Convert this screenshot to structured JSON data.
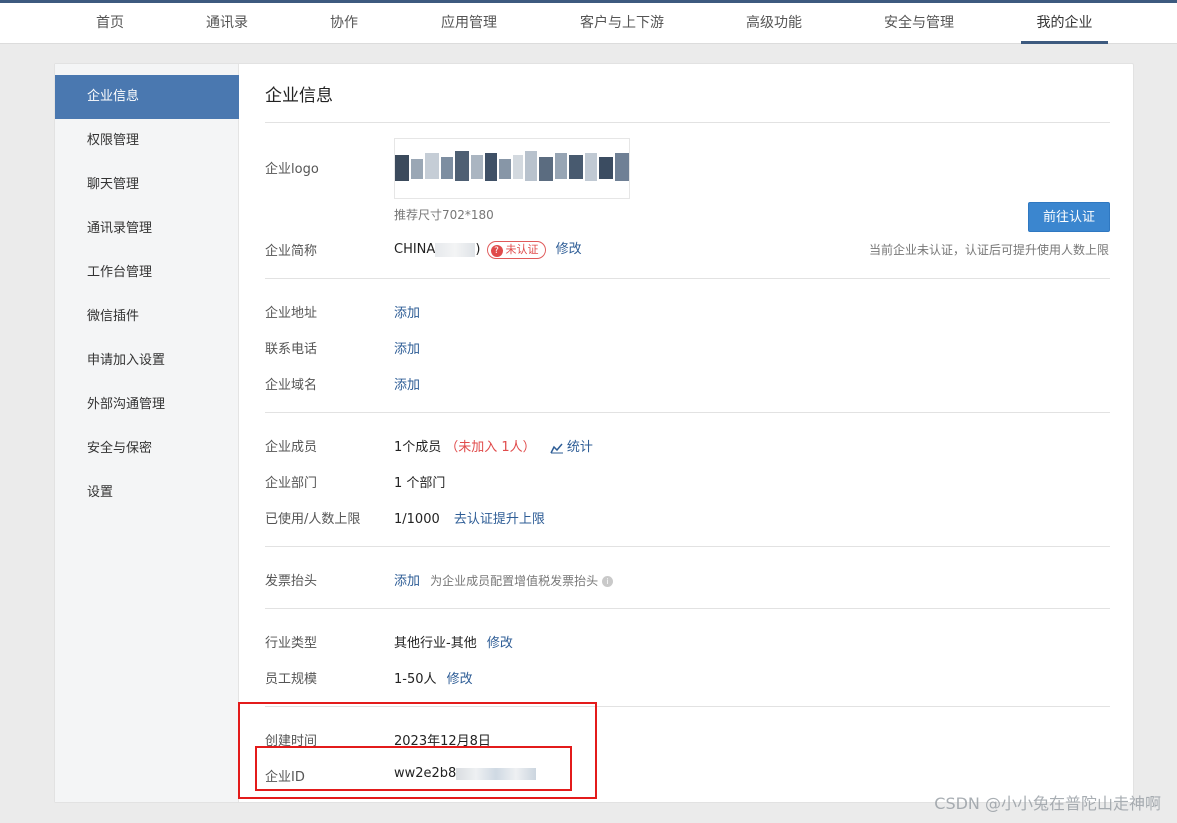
{
  "topnav": {
    "tabs": [
      {
        "label": "首页"
      },
      {
        "label": "通讯录"
      },
      {
        "label": "协作"
      },
      {
        "label": "应用管理"
      },
      {
        "label": "客户与上下游"
      },
      {
        "label": "高级功能"
      },
      {
        "label": "安全与管理"
      },
      {
        "label": "我的企业",
        "active": true
      }
    ]
  },
  "sidebar": {
    "items": [
      {
        "label": "企业信息",
        "active": true
      },
      {
        "label": "权限管理"
      },
      {
        "label": "聊天管理"
      },
      {
        "label": "通讯录管理"
      },
      {
        "label": "工作台管理"
      },
      {
        "label": "微信插件"
      },
      {
        "label": "申请加入设置"
      },
      {
        "label": "外部沟通管理"
      },
      {
        "label": "安全与保密"
      },
      {
        "label": "设置"
      }
    ]
  },
  "main": {
    "title": "企业信息",
    "logo": {
      "label": "企业logo",
      "hint": "推荐尺寸702*180"
    },
    "short_name": {
      "label": "企业简称",
      "value": "CHINA",
      "value_suffix": ")",
      "badge": "未认证",
      "edit": "修改"
    },
    "verify_button": "前往认证",
    "verify_note": "当前企业未认证，认证后可提升使用人数上限",
    "address": {
      "label": "企业地址",
      "action": "添加"
    },
    "phone": {
      "label": "联系电话",
      "action": "添加"
    },
    "domain": {
      "label": "企业域名",
      "action": "添加"
    },
    "members": {
      "label": "企业成员",
      "value": "1个成员",
      "pending": "（未加入 1人）",
      "stats": "统计"
    },
    "departments": {
      "label": "企业部门",
      "value": "1 个部门"
    },
    "usage": {
      "label": "已使用/人数上限",
      "value": "1/1000",
      "link": "去认证提升上限"
    },
    "invoice": {
      "label": "发票抬头",
      "action": "添加",
      "hint": "为企业成员配置增值税发票抬头"
    },
    "industry": {
      "label": "行业类型",
      "value": "其他行业-其他",
      "edit": "修改"
    },
    "scale": {
      "label": "员工规模",
      "value": "1-50人",
      "edit": "修改"
    },
    "created": {
      "label": "创建时间",
      "value": "2023年12月8日"
    },
    "corp_id": {
      "label": "企业ID",
      "value": "ww2e2b8"
    }
  },
  "watermark": "CSDN @小小兔在普陀山走神啊",
  "colors": {
    "accent": "#4a78b0",
    "nav_underline": "#3d5a7f",
    "link": "#2e5d96",
    "warning": "#e04b4b",
    "button": "#3b86cf",
    "highlight_box": "#e31b1b"
  }
}
